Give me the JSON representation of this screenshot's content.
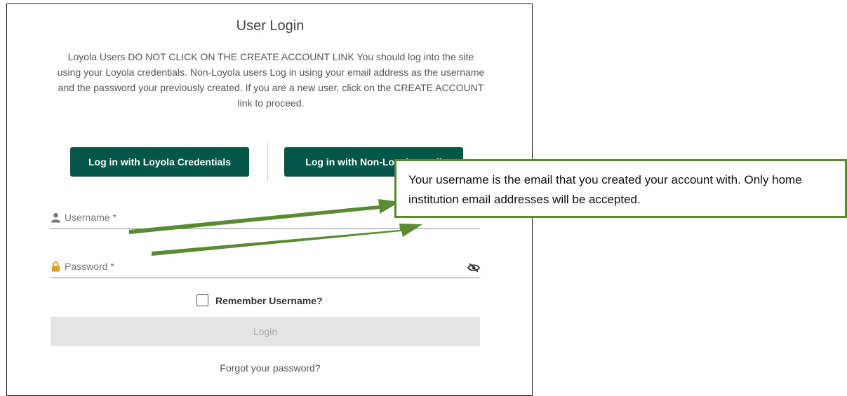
{
  "login": {
    "title": "User Login",
    "instructions": "Loyola Users DO NOT CLICK ON THE CREATE ACCOUNT LINK You should log into the site using your Loyola credentials. Non-Loyola users Log in using your email address as the username and the password your previously created. If you are a new user, click on the CREATE ACCOUNT link to proceed.",
    "loyola_button": "Log in with Loyola Credentials",
    "nonloyola_button": "Log in with Non-Loyola email",
    "username_placeholder": "Username *",
    "password_placeholder": "Password *",
    "remember_label": "Remember Username?",
    "remember_checked": false,
    "login_button": "Login",
    "forgot_link": "Forgot your password?"
  },
  "callout": {
    "text": "Your username is the email that you created your account with. Only home institution email addresses will be accepted."
  },
  "icons": {
    "username": "user-icon",
    "password": "lock-icon",
    "visibility": "eye-slash-icon"
  },
  "colors": {
    "primary_button": "#035748",
    "callout_border": "#5a8a32",
    "arrow": "#5a8a32",
    "lock": "#e0a020"
  }
}
